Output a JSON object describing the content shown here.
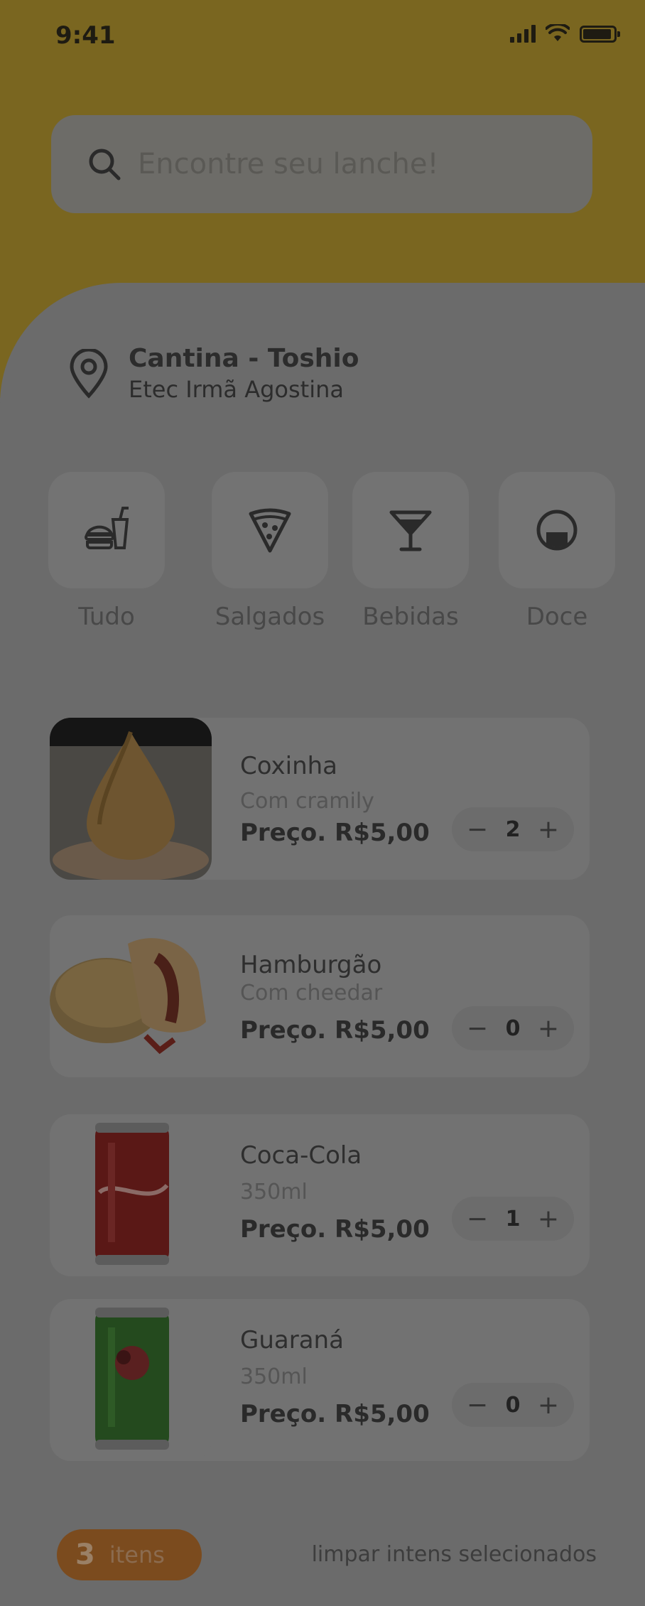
{
  "status_bar": {
    "time": "9:41"
  },
  "search": {
    "placeholder": "Encontre seu lanche!"
  },
  "location": {
    "name": "Cantina - Toshio",
    "school": "Etec Irmã Agostina"
  },
  "categories": [
    {
      "label": "Tudo",
      "icon": "burger-drink-icon"
    },
    {
      "label": "Salgados",
      "icon": "pizza-slice-icon"
    },
    {
      "label": "Bebidas",
      "icon": "cocktail-glass-icon"
    },
    {
      "label": "Doce",
      "icon": "cake-icon"
    }
  ],
  "products": [
    {
      "name": "Coxinha",
      "description": "Com cramily",
      "price": "Preço. R$5,00",
      "quantity": "2"
    },
    {
      "name": "Hamburgão",
      "description": "Com cheedar",
      "price": "Preço. R$5,00",
      "quantity": "0"
    },
    {
      "name": "Coca-Cola",
      "description": "350ml",
      "price": "Preço. R$5,00",
      "quantity": "1"
    },
    {
      "name": "Guaraná",
      "description": "350ml",
      "price": "Preço. R$5,00",
      "quantity": "0"
    }
  ],
  "cart": {
    "count": "3",
    "label": "itens",
    "clear_label": "limpar intens selecionados"
  },
  "colors": {
    "header_yellow": "#7a6620",
    "background": "#6b6b6b",
    "cart_orange": "#7b4b1e"
  }
}
